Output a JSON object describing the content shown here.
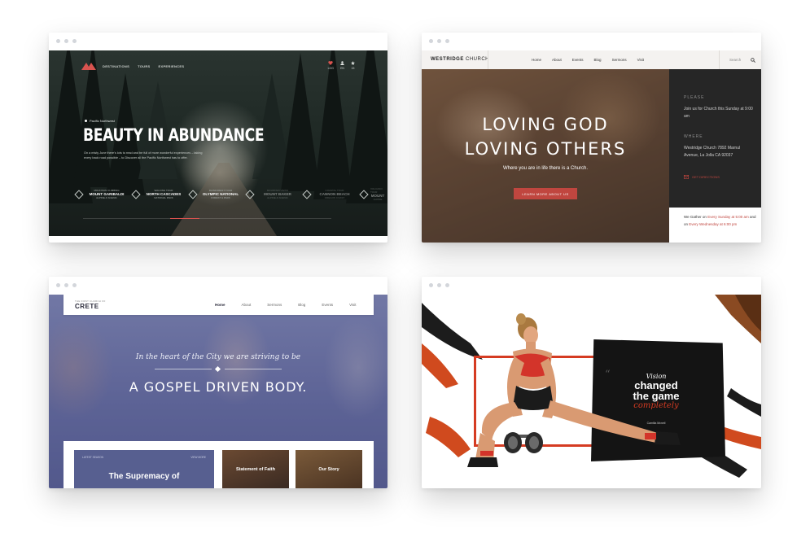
{
  "colors": {
    "accent_red": "#c0463f",
    "fitness_orange": "#d53b22",
    "crete_blue": "#575f90",
    "dark_panel": "#262626"
  },
  "forest": {
    "logo_icon": "mountain-logo-icon",
    "nav": [
      "DESTINATIONS",
      "TOURS",
      "EXPERIENCES"
    ],
    "right_icons": [
      {
        "icon": "heart-icon",
        "label": "LOG"
      },
      {
        "icon": "user-icon",
        "label": "EN"
      },
      {
        "icon": "star-icon",
        "label": "15"
      }
    ],
    "eyebrow": "Pacific Northwest",
    "title": "BEAUTY IN ABUNDANCE",
    "description": "On a misty June there's lots to read and be full of more wonderful experiences – taking every back road possible – to Discover all the Pacific Northwest has to offer.",
    "stops": [
      {
        "sub_top": "MOUNTAIN CLIMBING",
        "name": "MOUNT GARIBALDI",
        "sub_bottom": "ALPINE & SCENIC"
      },
      {
        "sub_top": "WALKING TOUR",
        "name": "NORTH CASCADES",
        "sub_bottom": "NATIONAL PARK"
      },
      {
        "sub_top": "RAINFOREST TOUR",
        "name": "OLYMPIC NATIONAL",
        "sub_bottom": "FOREST & PARK"
      },
      {
        "sub_top": "MOUNTAIN VIEWS",
        "name": "MOUNT BAKER",
        "sub_bottom": "ALPINE & SCENIC"
      },
      {
        "sub_top": "COASTAL TOUR",
        "name": "CANNON BEACH",
        "sub_bottom": "OREGON COAST"
      },
      {
        "sub_top": "VOLCANO TOUR",
        "name": "MOUNT",
        "sub_bottom": "ALPINE"
      }
    ],
    "progress": 0.12
  },
  "westridge": {
    "brand_bold": "WESTRIDGE",
    "brand_rest": " CHURCH",
    "nav": [
      "Home",
      "About",
      "Events",
      "Blog",
      "Sermons",
      "Visit"
    ],
    "search_placeholder": "Search",
    "search_icon": "search-icon",
    "heading_line1": "LOVING GOD",
    "heading_line2": "LOVING OTHERS",
    "subheading": "Where you are in life there is a Church.",
    "cta": "LEARN MORE ABOUT US",
    "please_label": "PLEASE",
    "please_text": "Join us for Church this Sunday at 9:00 am",
    "where_label": "WHERE",
    "where_text": "Westridge Church 7892 Marnul Avenue, La Jolla CA 92037",
    "directions": "GET DIRECTIONS",
    "gather_prefix": "We Gather on ",
    "gather_day1": "Every Sunday at 5:00 am",
    "gather_mid": " and on ",
    "gather_day2": "Every Wednesday at 6:00 pm"
  },
  "crete": {
    "logo_small": "THE FIRST CHURCH OF",
    "logo": "CRETE",
    "nav": [
      "Home",
      "About",
      "Sermons",
      "Blog",
      "Events",
      "Visit"
    ],
    "tagline": "In the heart of the City we are striving to be",
    "title": "A GOSPEL DRIVEN BODY.",
    "card1_left": "LATEST SEASON",
    "card1_right": "VIEW MORE",
    "card1_title": "The Supremacy of",
    "card2_title": "Statement of Faith",
    "card3_title": "Our Story"
  },
  "fitness": {
    "quote_mark": "“",
    "line1": "Vision",
    "line2a": "changed",
    "line2b": "the game",
    "line3": "completely",
    "author": "Camilla Mcneil"
  }
}
